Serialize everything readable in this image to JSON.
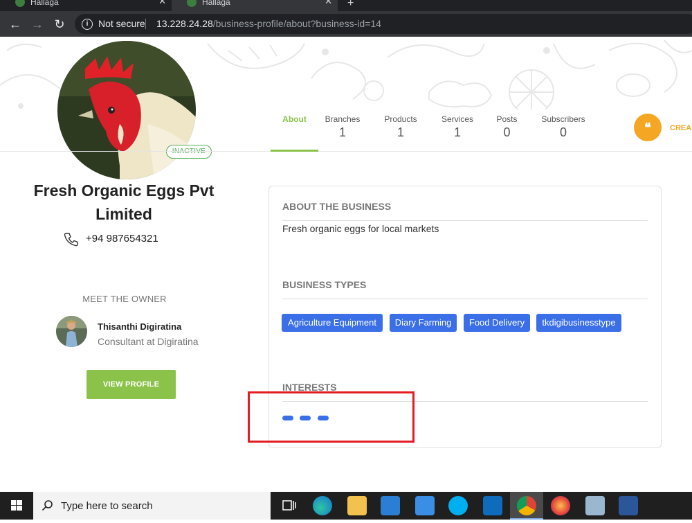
{
  "browser": {
    "tabs": [
      {
        "title": "Hallaga"
      },
      {
        "title": "Hallaga"
      }
    ],
    "security_label": "Not secure",
    "url_host": "13.228.24.28",
    "url_path": "/business-profile/about?business-id=14"
  },
  "profile": {
    "status_badge": "INACTIVE",
    "business_name": "Fresh Organic Eggs Pvt Limited",
    "phone": "+94 987654321"
  },
  "owner": {
    "section_title": "MEET THE OWNER",
    "name": "Thisanthi Digiratina",
    "role": "Consultant at Digiratina",
    "view_profile_label": "VIEW PROFILE"
  },
  "profile_tabs": [
    {
      "label": "About",
      "count": ""
    },
    {
      "label": "Branches",
      "count": "1"
    },
    {
      "label": "Products",
      "count": "1"
    },
    {
      "label": "Services",
      "count": "1"
    },
    {
      "label": "Posts",
      "count": "0"
    },
    {
      "label": "Subscribers",
      "count": "0"
    }
  ],
  "create_button": {
    "label": "CREA",
    "icon": "quote-icon"
  },
  "about": {
    "title": "ABOUT THE BUSINESS",
    "text": "Fresh organic eggs for local markets",
    "types_title": "BUSINESS TYPES",
    "types": [
      "Agriculture Equipment",
      "Diary Farming",
      "Food Delivery",
      "tkdigibusinesstype"
    ],
    "interests_title": "INTERESTS"
  },
  "taskbar": {
    "search_placeholder": "Type here to search"
  },
  "colors": {
    "accent_green": "#8bc34a",
    "tag_blue": "#3a6fe8",
    "create_orange": "#f5a623",
    "highlight_red": "#e31c23"
  }
}
